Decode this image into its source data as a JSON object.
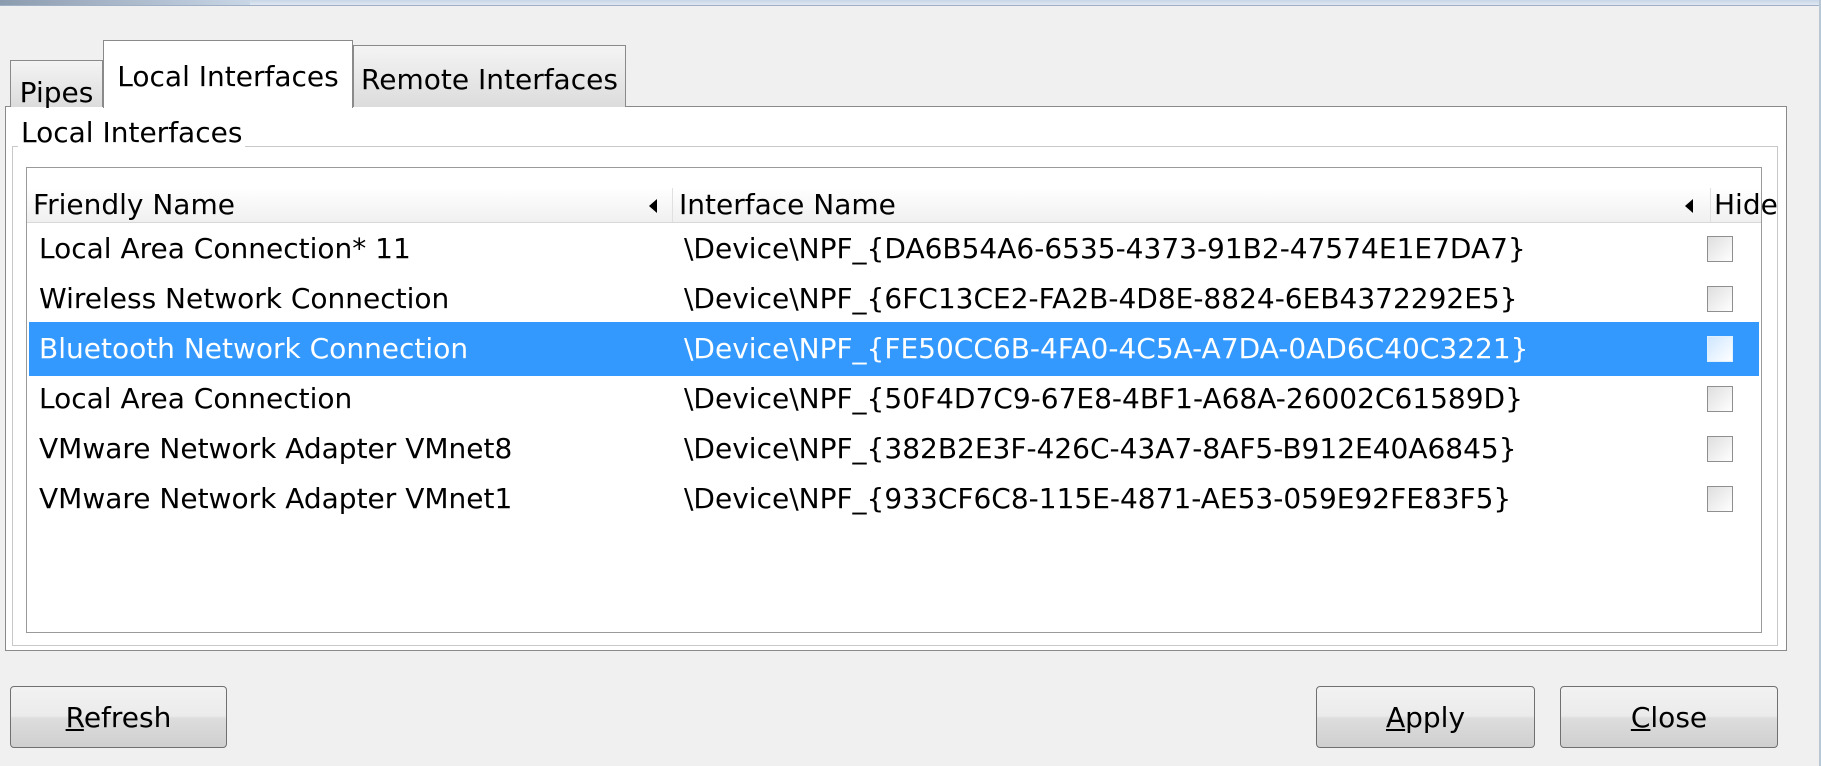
{
  "tabs": [
    {
      "label": "Pipes"
    },
    {
      "label": "Local Interfaces"
    },
    {
      "label": "Remote Interfaces"
    }
  ],
  "active_tab": "Local Interfaces",
  "group": {
    "title": "Local Interfaces"
  },
  "table": {
    "columns": {
      "friendly_name": "Friendly Name",
      "interface_name": "Interface Name",
      "hide": "Hide"
    },
    "rows": [
      {
        "friendly_name": "Local Area Connection* 11",
        "interface_name": "\\Device\\NPF_{DA6B54A6-6535-4373-91B2-47574E1E7DA7}",
        "hide": false,
        "selected": false
      },
      {
        "friendly_name": "Wireless Network Connection",
        "interface_name": "\\Device\\NPF_{6FC13CE2-FA2B-4D8E-8824-6EB4372292E5}",
        "hide": false,
        "selected": false
      },
      {
        "friendly_name": "Bluetooth Network Connection",
        "interface_name": "\\Device\\NPF_{FE50CC6B-4FA0-4C5A-A7DA-0AD6C40C3221}",
        "hide": false,
        "selected": true
      },
      {
        "friendly_name": "Local Area Connection",
        "interface_name": "\\Device\\NPF_{50F4D7C9-67E8-4BF1-A68A-26002C61589D}",
        "hide": false,
        "selected": false
      },
      {
        "friendly_name": "VMware Network Adapter VMnet8",
        "interface_name": "\\Device\\NPF_{382B2E3F-426C-43A7-8AF5-B912E40A6845}",
        "hide": false,
        "selected": false
      },
      {
        "friendly_name": "VMware Network Adapter VMnet1",
        "interface_name": "\\Device\\NPF_{933CF6C8-115E-4871-AE53-059E92FE83F5}",
        "hide": false,
        "selected": false
      }
    ]
  },
  "buttons": {
    "refresh": {
      "mnemonic": "R",
      "rest": "efresh"
    },
    "apply": {
      "mnemonic": "A",
      "rest": "pply"
    },
    "close": {
      "mnemonic": "C",
      "rest": "lose"
    }
  },
  "colors": {
    "selection": "#3399ff",
    "selection_text": "#ffffff",
    "background": "#f0f0f0",
    "panel": "#ffffff"
  },
  "icons": {
    "sort_indicator": "triangle-left-icon",
    "hide_checkbox": "checkbox-unchecked-icon"
  }
}
